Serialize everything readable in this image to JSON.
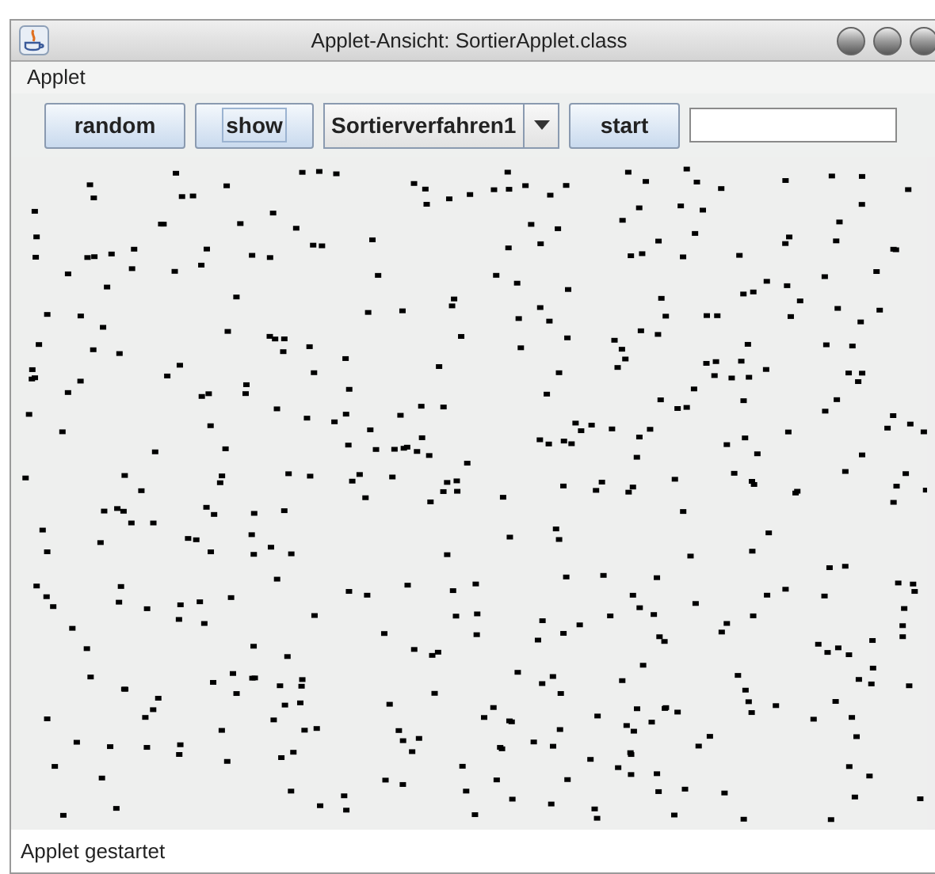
{
  "window": {
    "title": "Applet-Ansicht: SortierApplet.class"
  },
  "menu": [
    "Applet"
  ],
  "toolbar": {
    "buttons": [
      {
        "label": "random",
        "focused": false
      },
      {
        "label": "show",
        "focused": true
      }
    ],
    "combo": {
      "value": "Sortierverfahren1"
    },
    "start": {
      "label": "start",
      "focused": false
    }
  },
  "status_bar": "Applet gestartet"
}
